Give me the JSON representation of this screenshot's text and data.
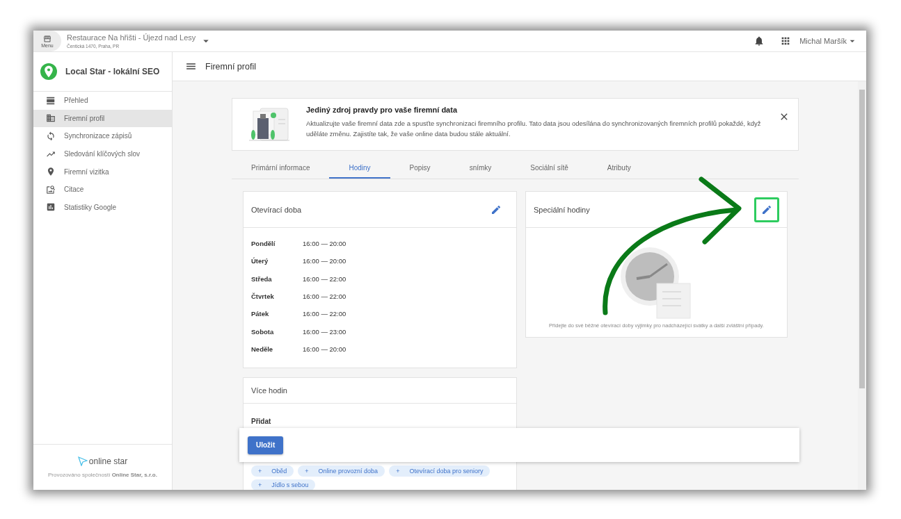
{
  "topbar": {
    "menu_label": "Menu",
    "business_name": "Restaurace Na hřišti - Újezd nad Lesy",
    "business_address": "Čentická 1470, Praha, PR",
    "user": "Michal Maršík"
  },
  "sidebar": {
    "app_title": "Local Star - lokální SEO",
    "items": [
      {
        "label": "Přehled",
        "selected": false
      },
      {
        "label": "Firemní profil",
        "selected": true
      },
      {
        "label": "Synchronizace zápisů",
        "selected": false
      },
      {
        "label": "Sledování klíčových slov",
        "selected": false
      },
      {
        "label": "Firemní vizitka",
        "selected": false
      },
      {
        "label": "Citace",
        "selected": false
      },
      {
        "label": "Statistiky Google",
        "selected": false
      }
    ],
    "footer_logo": "online star",
    "footer_text": "Provozováno společností **Online Star, s.r.o.**"
  },
  "page_title": "Firemní profil",
  "banner": {
    "title": "Jediný zdroj pravdy pro vaše firemní data",
    "text": "Aktualizujte vaše firemní data zde a spusťte synchronizaci firemního profilu. Tato data jsou odesílána do synchronizovaných firemních profilů pokaždé, když uděláte změnu. Zajistíte tak, že vaše online data budou stále aktuální."
  },
  "tabs": [
    {
      "label": "Primární informace",
      "selected": false
    },
    {
      "label": "Hodiny",
      "selected": true
    },
    {
      "label": "Popisy",
      "selected": false
    },
    {
      "label": "snímky",
      "selected": false
    },
    {
      "label": "Sociální sítě",
      "selected": false
    },
    {
      "label": "Atributy",
      "selected": false
    }
  ],
  "opening_hours": {
    "title": "Otevírací doba",
    "highlighted": false,
    "days": [
      {
        "day": "Pondělí",
        "hours": "16:00 — 20:00"
      },
      {
        "day": "Úterý",
        "hours": "16:00 — 20:00"
      },
      {
        "day": "Středa",
        "hours": "16:00 — 22:00"
      },
      {
        "day": "Čtvrtek",
        "hours": "16:00 — 22:00"
      },
      {
        "day": "Pátek",
        "hours": "16:00 — 22:00"
      },
      {
        "day": "Sobota",
        "hours": "16:00 — 23:00"
      },
      {
        "day": "Neděle",
        "hours": "16:00 — 20:00"
      }
    ]
  },
  "special_hours": {
    "title": "Speciální hodiny",
    "highlighted": true,
    "empty_text": "Přidejte do své běžné otevírací doby výjimky pro nadcházející svátky a další zvláštní případy."
  },
  "more_hours": {
    "title": "Více hodin",
    "add_label": "Přidat",
    "chips": [
      {
        "icon": "+",
        "label": "Oběd"
      },
      {
        "icon": "+",
        "label": "Online provozní doba"
      },
      {
        "icon": "+",
        "label": "Otevírací doba pro seniory"
      },
      {
        "icon": "+",
        "label": "Jídlo s sebou"
      }
    ]
  },
  "save_button": "Uložit"
}
